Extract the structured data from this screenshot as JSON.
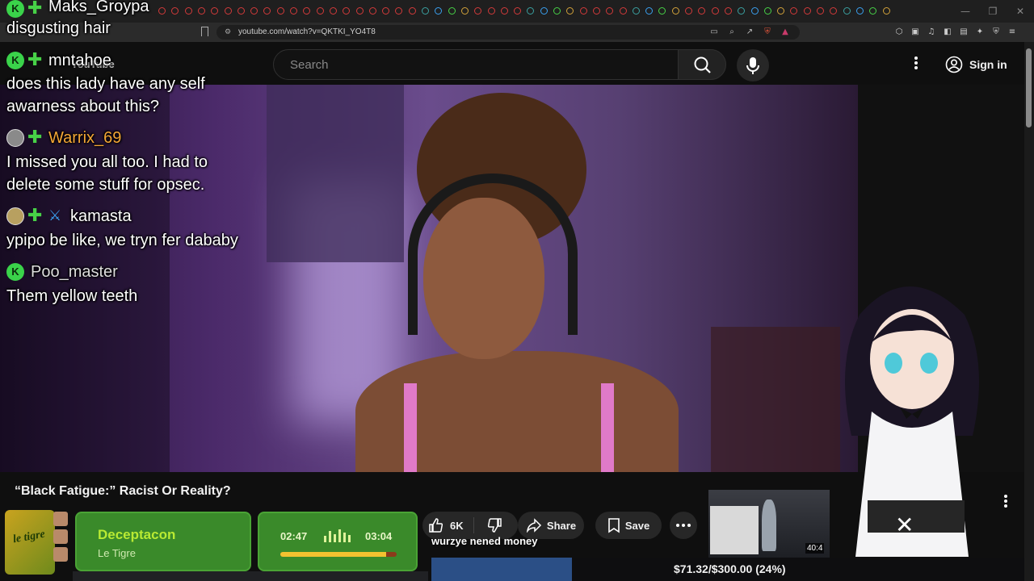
{
  "browser": {
    "url": "youtube.com/watch?v=QKTKI_YO4T8",
    "window_controls": [
      "—",
      "❐",
      "✕"
    ]
  },
  "youtube": {
    "logo_text": "YouTube",
    "search_placeholder": "Search",
    "sign_in_label": "Sign in"
  },
  "chat": {
    "messages": [
      {
        "user": "Maks_Groypa",
        "text": "disgusting hair",
        "user_color": "#ffffff"
      },
      {
        "user": "mntahoe",
        "text": "does this lady have any self awarness about this?",
        "text_line1": "does this lady have any self",
        "text_line2": "awarness about this?",
        "user_color": "#ffffff"
      },
      {
        "user": "Warrix_69",
        "text_line1": "I missed you all too. I had to",
        "text_line2": "delete some stuff for opsec.",
        "user_color": "#f4a736"
      },
      {
        "user": "kamasta",
        "text": "ypipo be like, we tryn fer dababy",
        "user_color": "#ffffff"
      },
      {
        "user": "Poo_master",
        "text": "Them yellow teeth",
        "user_color": "#dddddd"
      }
    ]
  },
  "video": {
    "title": "“Black Fatigue:” Racist Or Reality?",
    "like_count": "6K",
    "share_label": "Share",
    "save_label": "Save",
    "thumbnail_duration": "40:4"
  },
  "now_playing": {
    "song_title": "Deceptacon",
    "artist": "Le Tigre",
    "album_art_text": "le tigre",
    "elapsed": "02:47",
    "total": "03:04",
    "progress_fraction": 0.9076
  },
  "ticker": {
    "text": "wurzye nened money"
  },
  "donation": {
    "text": "$71.32/$300.00 (24%)",
    "progress_fraction": 0.2377
  },
  "colors": {
    "accent_green": "#3a8a2a",
    "song_title_color": "#b8ea33",
    "progress_yellow": "#f2c230",
    "donation_fill": "#2b4f86"
  }
}
